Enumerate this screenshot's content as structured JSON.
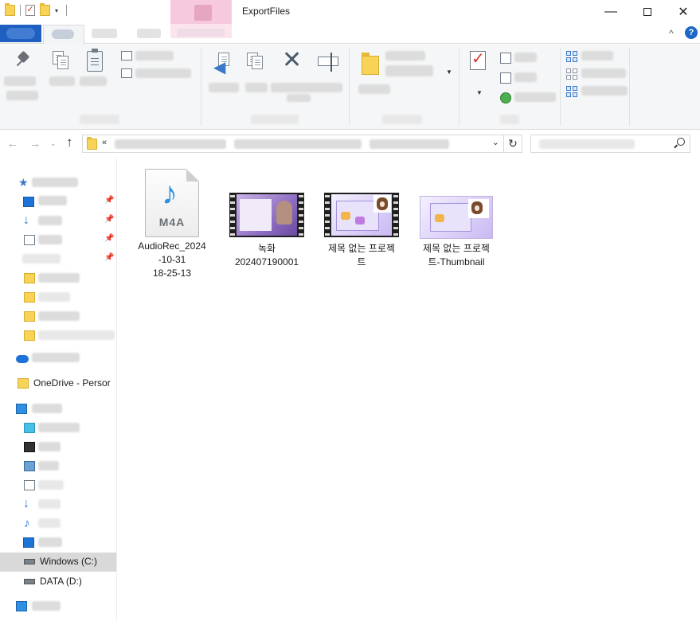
{
  "window": {
    "title": "ExportFiles",
    "minimize_glyph": "—",
    "close_glyph": "✕"
  },
  "ribbon": {
    "collapse_glyph": "^",
    "help_glyph": "?"
  },
  "address": {
    "chevron": "«",
    "dropdown_glyph": "⌄",
    "refresh_glyph": "↻"
  },
  "navigation": {
    "back_glyph": "←",
    "forward_glyph": "→",
    "recent_glyph": "⌄",
    "up_glyph": "↑"
  },
  "nav_pane": {
    "onedrive_personal": "OneDrive - Persor",
    "drive_c": "Windows (C:)",
    "drive_d": "DATA (D:)"
  },
  "files": [
    {
      "name": "AudioRec_2024\n-10-31\n18-25-13",
      "type": "m4a",
      "badge": "M4A"
    },
    {
      "name": "녹화\n202407190001",
      "type": "video"
    },
    {
      "name": "제목 없는 프로젝\n트",
      "type": "video"
    },
    {
      "name": "제목 없는 프로젝\n트-Thumbnail",
      "type": "image"
    }
  ],
  "colors": {
    "accent": "#1e5fbf",
    "selected_row": "#d9d9d9",
    "folder_yellow": "#f7d358"
  }
}
